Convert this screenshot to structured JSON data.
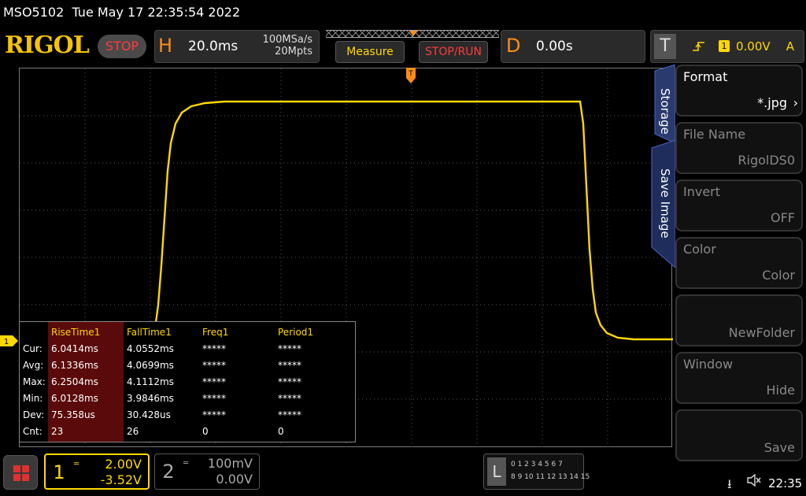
{
  "status": {
    "model": "MSO5102",
    "datetime": "Tue May 17 22:35:54 2022"
  },
  "brand": {
    "logo": "RIGOL",
    "run_state": "STOP"
  },
  "horizontal": {
    "letter": "H",
    "timebase": "20.0ms",
    "sample_rate": "100MSa/s",
    "memory_depth": "20Mpts"
  },
  "buttons": {
    "measure": "Measure",
    "stop_run": "STOP/RUN"
  },
  "delay": {
    "letter": "D",
    "value": "0.00s"
  },
  "trigger": {
    "letter": "T",
    "source": "1",
    "level": "0.00V",
    "mode": "A"
  },
  "measurements": {
    "row_labels": [
      "Cur:",
      "Avg:",
      "Max:",
      "Min:",
      "Dev:",
      "Cnt:"
    ],
    "columns": [
      {
        "header": "RiseTime1",
        "values": [
          "6.0414ms",
          "6.1336ms",
          "6.2504ms",
          "6.0128ms",
          "75.358us",
          "23"
        ]
      },
      {
        "header": "FallTime1",
        "values": [
          "4.0552ms",
          "4.0699ms",
          "4.1112ms",
          "3.9846ms",
          "30.428us",
          "26"
        ]
      },
      {
        "header": "Freq1",
        "values": [
          "*****",
          "*****",
          "*****",
          "*****",
          "*****",
          "0"
        ]
      },
      {
        "header": "Period1",
        "values": [
          "*****",
          "*****",
          "*****",
          "*****",
          "*****",
          "0"
        ]
      }
    ]
  },
  "side_menu": {
    "tabs": [
      "Storage",
      "Save Image"
    ],
    "items": [
      {
        "label": "Format",
        "value": "*.jpg"
      },
      {
        "label": "File Name",
        "value": "RigolDS0"
      },
      {
        "label": "Invert",
        "value": "OFF"
      },
      {
        "label": "Color",
        "value": "Color"
      },
      {
        "label": "",
        "value": "NewFolder"
      },
      {
        "label": "Window",
        "value": "Hide"
      },
      {
        "label": "",
        "value": "Save"
      }
    ]
  },
  "channels": [
    {
      "number": "1",
      "scale": "2.00V",
      "offset": "-3.52V"
    },
    {
      "number": "2",
      "scale": "100mV",
      "offset": "0.00V"
    }
  ],
  "ch1_marker": "1",
  "logic": {
    "letter": "L",
    "row1": "0 1 2 3   4 5 6 7",
    "row2": "8 9 10 11  12 13 14 15"
  },
  "clock": "22:35",
  "colors": {
    "ch1": "#ffd800",
    "accent": "#ff8c1a",
    "stop": "#ff3b3b",
    "meas_header_bg": "#5a0a0a"
  }
}
